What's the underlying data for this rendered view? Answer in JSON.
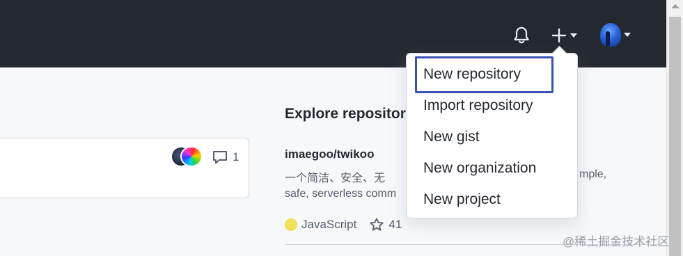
{
  "header": {
    "notifications_icon": "bell-icon",
    "create_icon": "plus-icon",
    "avatar_icon": "user-avatar"
  },
  "create_menu": {
    "items": [
      {
        "label": "New repository",
        "focused": true
      },
      {
        "label": "Import repository"
      },
      {
        "label": "New gist"
      },
      {
        "label": "New organization"
      },
      {
        "label": "New project"
      }
    ]
  },
  "feed_card": {
    "comment_count": "1"
  },
  "explore": {
    "title": "Explore repositor",
    "repo": {
      "name": "imaegoo/twikoo",
      "description_line1": "一个简洁、安全、无",
      "description_line1_tail": "mple,",
      "description_line2": "safe, serverless comm",
      "language": "JavaScript",
      "language_color": "#f1e05a",
      "stars": "41"
    }
  },
  "watermark": "@稀土掘金技术社区",
  "colors": {
    "header_bg": "#24292f",
    "focus_ring": "#3b52b4"
  }
}
